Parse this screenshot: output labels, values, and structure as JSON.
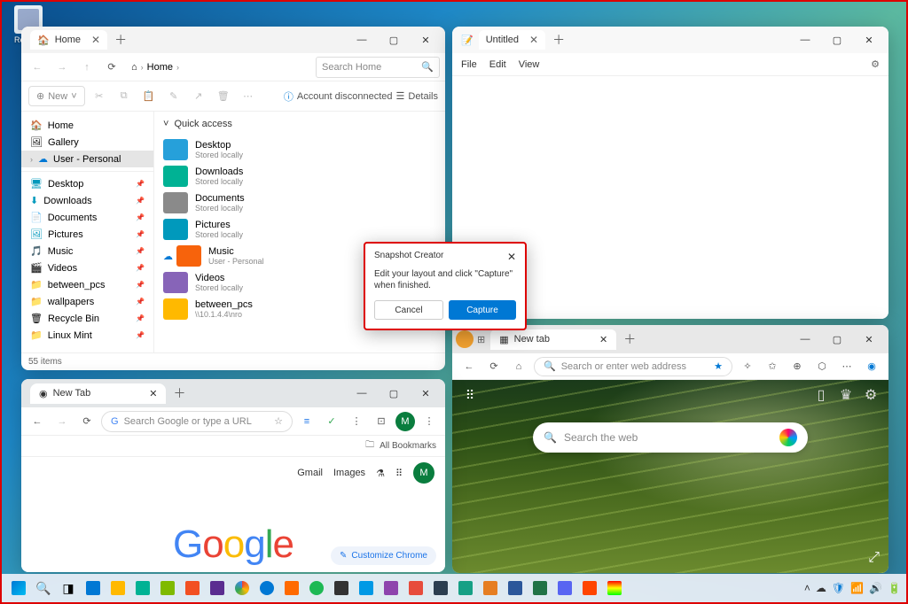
{
  "desktop": {
    "recycle_bin": "Recycle Bin"
  },
  "explorer": {
    "tab_title": "Home",
    "breadcrumb": [
      "Home"
    ],
    "search_placeholder": "Search Home",
    "toolbar": {
      "new": "New",
      "account_msg": "Account disconnected",
      "details": "Details"
    },
    "nav": {
      "top": [
        {
          "label": "Home",
          "icon": "home"
        },
        {
          "label": "Gallery",
          "icon": "gallery"
        },
        {
          "label": "User - Personal",
          "icon": "onedrive",
          "selected": true
        }
      ],
      "pinned": [
        {
          "label": "Desktop"
        },
        {
          "label": "Downloads"
        },
        {
          "label": "Documents"
        },
        {
          "label": "Pictures"
        },
        {
          "label": "Music"
        },
        {
          "label": "Videos"
        },
        {
          "label": "between_pcs"
        },
        {
          "label": "wallpapers"
        },
        {
          "label": "Recycle Bin"
        },
        {
          "label": "Linux Mint"
        }
      ]
    },
    "quick_access_label": "Quick access",
    "quick_items": [
      {
        "name": "Desktop",
        "sub": "Stored locally",
        "color": "fc-blue"
      },
      {
        "name": "Downloads",
        "sub": "Stored locally",
        "color": "fc-teal"
      },
      {
        "name": "Documents",
        "sub": "Stored locally",
        "color": "fc-gray"
      },
      {
        "name": "Pictures",
        "sub": "Stored locally",
        "color": "fc-cyan"
      },
      {
        "name": "Music",
        "sub": "User - Personal",
        "color": "fc-orange"
      },
      {
        "name": "Videos",
        "sub": "Stored locally",
        "color": "fc-purple"
      },
      {
        "name": "between_pcs",
        "sub": "\\\\10.1.4.4\\nro",
        "color": "fc-yellow"
      }
    ],
    "status": "55 items"
  },
  "notepad": {
    "tab_title": "Untitled",
    "menu": {
      "file": "File",
      "edit": "Edit",
      "view": "View"
    }
  },
  "edge": {
    "tab_title": "New tab",
    "addr_placeholder": "Search or enter web address",
    "search_placeholder": "Search the web"
  },
  "chrome": {
    "tab_title": "New Tab",
    "omni_placeholder": "Search Google or type a URL",
    "bookmarks_label": "All Bookmarks",
    "links": {
      "gmail": "Gmail",
      "images": "Images"
    },
    "avatar_letter": "M",
    "logo": "Google",
    "customize_label": "Customize Chrome"
  },
  "dialog": {
    "title": "Snapshot Creator",
    "message": "Edit your layout and click \"Capture\" when finished.",
    "cancel": "Cancel",
    "capture": "Capture"
  }
}
